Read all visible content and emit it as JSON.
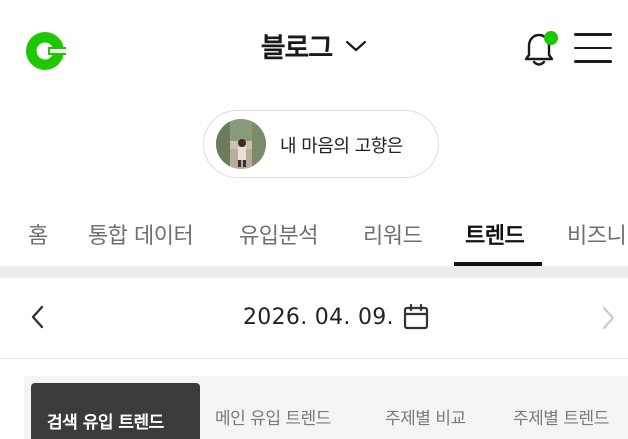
{
  "header": {
    "logo_icon": "naver-blog-logo-icon",
    "title": "블로그",
    "dropdown_icon": "chevron-down-icon",
    "notification_icon": "bell-icon",
    "notification_badge_color": "#1ec800",
    "menu_icon": "hamburger-menu-icon"
  },
  "profile": {
    "name": "내 마음의 고향은"
  },
  "tabs": [
    {
      "label": "홈",
      "active": false
    },
    {
      "label": "통합 데이터",
      "active": false
    },
    {
      "label": "유입분석",
      "active": false
    },
    {
      "label": "리워드",
      "active": false
    },
    {
      "label": "트렌드",
      "active": true
    },
    {
      "label": "비즈니",
      "active": false
    }
  ],
  "date_nav": {
    "date": "2026. 04. 09.",
    "prev_icon": "chevron-left-icon",
    "next_icon": "chevron-right-icon",
    "calendar_icon": "calendar-icon"
  },
  "subtabs": [
    {
      "label": "검색 유입 트렌드",
      "active": true
    },
    {
      "label": "메인 유입 트렌드",
      "active": false
    },
    {
      "label": "주제별 비교",
      "active": false
    },
    {
      "label": "주제별 트렌드",
      "active": false
    }
  ],
  "colors": {
    "brand_green": "#1ec800",
    "active_chip": "#3b3b3b"
  }
}
